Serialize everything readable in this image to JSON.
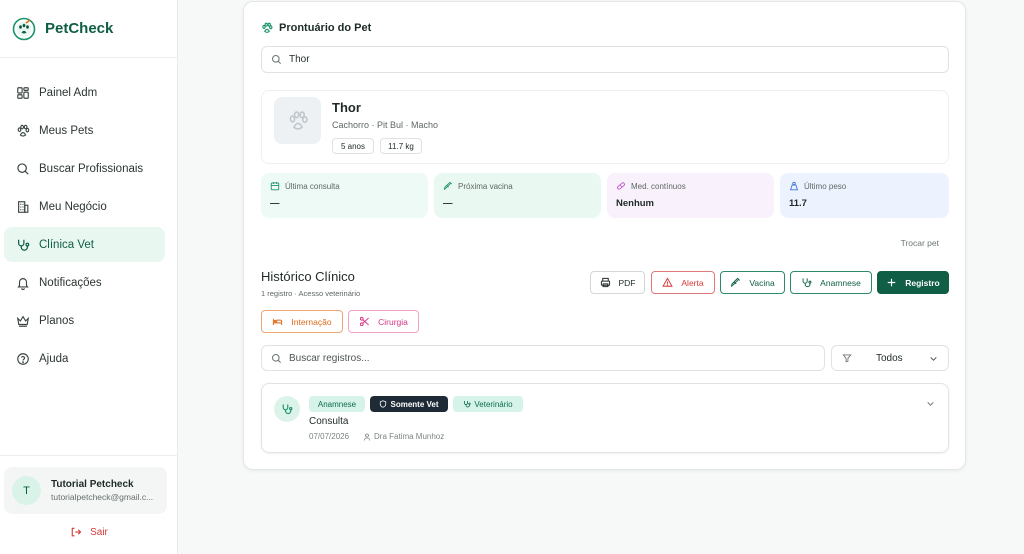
{
  "brand": {
    "name": "PetCheck"
  },
  "sidebar": {
    "items": [
      {
        "label": "Painel Adm",
        "icon": "dashboard-icon"
      },
      {
        "label": "Meus Pets",
        "icon": "paw-icon"
      },
      {
        "label": "Buscar Profissionais",
        "icon": "search-icon"
      },
      {
        "label": "Meu Negócio",
        "icon": "building-icon"
      },
      {
        "label": "Clínica Vet",
        "icon": "stethoscope-icon",
        "active": true
      },
      {
        "label": "Notificações",
        "icon": "bell-icon"
      },
      {
        "label": "Planos",
        "icon": "crown-icon"
      },
      {
        "label": "Ajuda",
        "icon": "help-icon"
      }
    ]
  },
  "user": {
    "initial": "T",
    "name": "Tutorial Petcheck",
    "email": "tutorialpetcheck@gmail.c..."
  },
  "logout": {
    "label": "Sair"
  },
  "panel": {
    "title": "Prontuário do Pet"
  },
  "search": {
    "value": "Thor"
  },
  "pet": {
    "name": "Thor",
    "info": "Cachorro · Pit Bul · Macho",
    "age": "5 anos",
    "weight": "11.7 kg"
  },
  "stats": [
    {
      "label": "Última consulta",
      "value": "—",
      "icon": "calendar-icon",
      "bg": "#eefaf5",
      "color": "#18926a"
    },
    {
      "label": "Próxima vacina",
      "value": "—",
      "icon": "syringe-icon",
      "bg": "#e9f8f0",
      "color": "#18926a"
    },
    {
      "label": "Med. contínuos",
      "value": "Nenhum",
      "icon": "pill-icon",
      "bg": "#f9f1fb",
      "color": "#c154c7"
    },
    {
      "label": "Último peso",
      "value": "11.7",
      "icon": "weight-icon",
      "bg": "#edf3fe",
      "color": "#3b6fd9"
    }
  ],
  "swap_pet": "Trocar pet",
  "history": {
    "title": "Histórico Clínico",
    "subtitle": "1 registro · Acesso veterinário",
    "buttons": {
      "pdf": "PDF",
      "alert": "Alerta",
      "vaccine": "Vacina",
      "anamnesis": "Anamnese",
      "record": "Registro",
      "hospitalization": "Internação",
      "surgery": "Cirurgia"
    },
    "search_placeholder": "Buscar registros...",
    "filter": "Todos"
  },
  "records": [
    {
      "badges": [
        "Anamnese",
        "Somente Vet",
        "Veterinário"
      ],
      "title": "Consulta",
      "date": "07/07/2026",
      "doctor": "Dra Fatima Munhoz"
    }
  ],
  "colors": {
    "brand": "#0f5e45",
    "accent": "#18926a",
    "danger": "#d63a3a",
    "warning": "#e06a1b",
    "pink": "#d63384"
  }
}
